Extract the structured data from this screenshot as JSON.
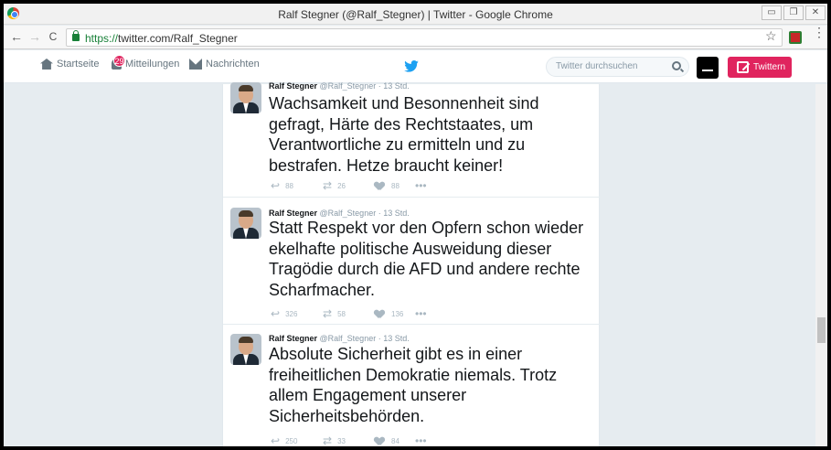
{
  "window": {
    "title": "Ralf Stegner (@Ralf_Stegner) | Twitter - Google Chrome",
    "buttons": {
      "minimize": "▭",
      "restore": "❐",
      "close": "✕"
    }
  },
  "browser": {
    "url_scheme": "https://",
    "url_rest": "twitter.com/Ralf_Stegner",
    "back_icon": "←",
    "forward_icon": "→",
    "reload_icon": "C",
    "star_icon": "☆",
    "menu_icon": "⋮"
  },
  "twitter_nav": {
    "home": "Startseite",
    "notifications": "Mitteilungen",
    "notifications_badge": "29",
    "messages": "Nachrichten",
    "search_placeholder": "Twitter durchsuchen",
    "tweet_button": "Twittern"
  },
  "tweets": [
    {
      "name": "Ralf Stegner",
      "handle": "@Ralf_Stegner",
      "time": "13 Std.",
      "text": "Wachsamkeit und Besonnenheit sind gefragt, Härte des Rechtstaates, um Verantwortliche zu ermitteln und zu bestrafen. Hetze braucht keiner!",
      "replies": "88",
      "retweets": "26",
      "likes": "88"
    },
    {
      "name": "Ralf Stegner",
      "handle": "@Ralf_Stegner",
      "time": "13 Std.",
      "text": "Statt Respekt vor den Opfern schon wieder ekelhafte politische Ausweidung dieser Tragödie durch die AFD und andere rechte Scharfmacher.",
      "replies": "326",
      "retweets": "58",
      "likes": "136"
    },
    {
      "name": "Ralf Stegner",
      "handle": "@Ralf_Stegner",
      "time": "13 Std.",
      "text": "Absolute Sicherheit gibt es in einer freiheitlichen Demokratie niemals. Trotz allem Engagement unserer Sicherheitsbehörden.",
      "replies": "250",
      "retweets": "33",
      "likes": "84"
    }
  ],
  "icons": {
    "reply": "reply-icon",
    "retweet": "retweet-icon",
    "like": "heart-icon",
    "more": "more-icon"
  },
  "colors": {
    "twitter_blue": "#1da1f2",
    "tweet_button": "#e0245e",
    "badge": "#e0245e",
    "background": "#e6ecf0"
  }
}
